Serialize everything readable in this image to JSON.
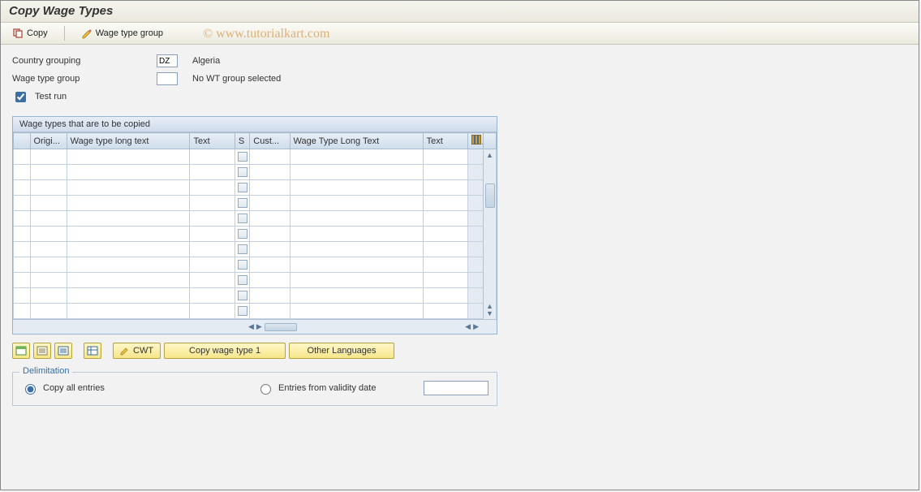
{
  "title": "Copy Wage Types",
  "watermark": "© www.tutorialkart.com",
  "toolbar": {
    "copy_label": "Copy",
    "wage_type_group_label": "Wage type group"
  },
  "form": {
    "country_grouping_label": "Country grouping",
    "country_grouping_value": "DZ",
    "country_grouping_text": "Algeria",
    "wage_type_group_label": "Wage type group",
    "wage_type_group_value": "",
    "wage_type_group_text": "No WT group selected",
    "test_run_label": "Test run",
    "test_run_checked": true
  },
  "grid": {
    "title": "Wage types that are to be copied",
    "columns": {
      "sel": "",
      "origi": "Origi...",
      "long_text_left": "Wage type long text",
      "text_left": "Text",
      "s": "S",
      "cust": "Cust...",
      "long_text_right": "Wage Type Long Text",
      "text_right": "Text"
    },
    "row_count": 11
  },
  "buttons": {
    "cwt_label": "CWT",
    "copy_wt1_label": "Copy wage type 1",
    "other_lang_label": "Other Languages"
  },
  "delimitation": {
    "legend": "Delimitation",
    "copy_all_label": "Copy all entries",
    "from_date_label": "Entries from validity date",
    "selected": "copy_all",
    "date_value": ""
  }
}
